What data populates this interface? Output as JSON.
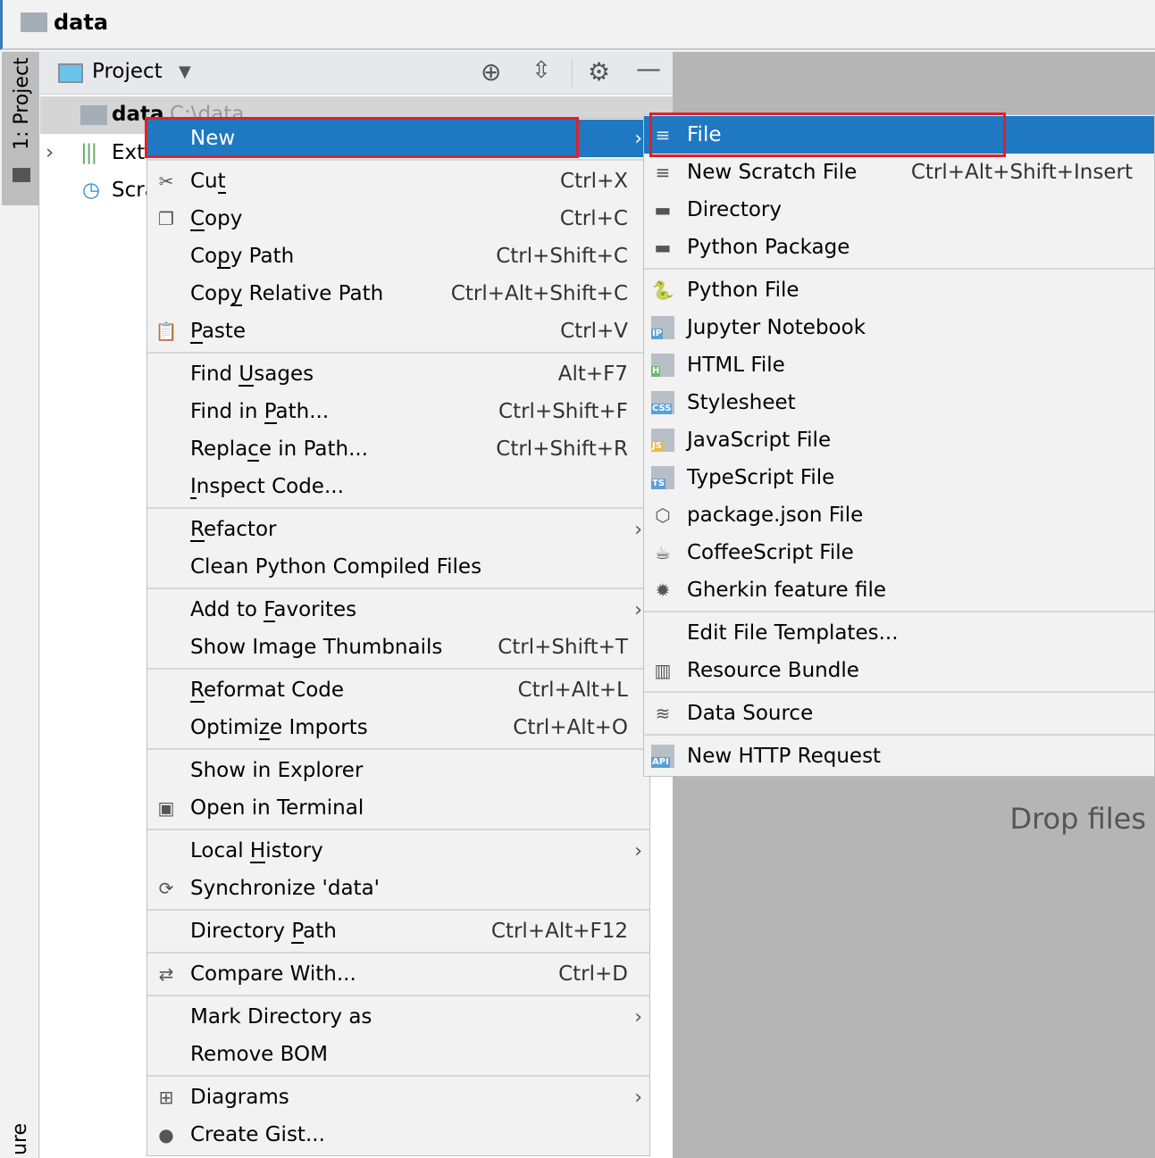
{
  "window": {
    "title": "data"
  },
  "sidebar": {
    "tab_label": "1: Project",
    "bottom_label": "ure"
  },
  "project_panel": {
    "title": "Project",
    "tree": [
      {
        "label": "data",
        "path": "C:\\data"
      },
      {
        "label": "Exte"
      },
      {
        "label": "Scra"
      }
    ]
  },
  "editor": {
    "drop_hint": "Drop files"
  },
  "context_menu": {
    "groups": [
      [
        {
          "label": "New",
          "submenu": true,
          "selected": true
        }
      ],
      [
        {
          "label": "Cut",
          "mn": 2,
          "shortcut": "Ctrl+X",
          "icon": "scissors-icon",
          "glyph": "✂"
        },
        {
          "label": "Copy",
          "mn": 0,
          "shortcut": "Ctrl+C",
          "icon": "copy-icon",
          "glyph": "❐"
        },
        {
          "label": "Copy Path",
          "mn": 2,
          "shortcut": "Ctrl+Shift+C"
        },
        {
          "label": "Copy Relative Path",
          "mn": 3,
          "shortcut": "Ctrl+Alt+Shift+C"
        },
        {
          "label": "Paste",
          "mn": 0,
          "shortcut": "Ctrl+V",
          "icon": "paste-icon",
          "glyph": "📋"
        }
      ],
      [
        {
          "label": "Find Usages",
          "mn": 5,
          "shortcut": "Alt+F7"
        },
        {
          "label": "Find in Path...",
          "mn": 8,
          "shortcut": "Ctrl+Shift+F"
        },
        {
          "label": "Replace in Path...",
          "mn": 5,
          "shortcut": "Ctrl+Shift+R"
        },
        {
          "label": "Inspect Code...",
          "mn": 0
        }
      ],
      [
        {
          "label": "Refactor",
          "mn": 0,
          "submenu": true
        },
        {
          "label": "Clean Python Compiled Files"
        }
      ],
      [
        {
          "label": "Add to Favorites",
          "mn": 7,
          "submenu": true
        },
        {
          "label": "Show Image Thumbnails",
          "shortcut": "Ctrl+Shift+T"
        }
      ],
      [
        {
          "label": "Reformat Code",
          "mn": 0,
          "shortcut": "Ctrl+Alt+L"
        },
        {
          "label": "Optimize Imports",
          "mn": 6,
          "shortcut": "Ctrl+Alt+O"
        }
      ],
      [
        {
          "label": "Show in Explorer"
        },
        {
          "label": "Open in Terminal",
          "icon": "terminal-icon",
          "glyph": "▣"
        }
      ],
      [
        {
          "label": "Local History",
          "mn": 6,
          "submenu": true
        },
        {
          "label": "Synchronize 'data'",
          "icon": "sync-icon",
          "glyph": "⟳"
        }
      ],
      [
        {
          "label": "Directory Path",
          "mn": 10,
          "shortcut": "Ctrl+Alt+F12"
        }
      ],
      [
        {
          "label": "Compare With...",
          "shortcut": "Ctrl+D",
          "icon": "compare-icon",
          "glyph": "⇄"
        }
      ],
      [
        {
          "label": "Mark Directory as",
          "submenu": true
        },
        {
          "label": "Remove BOM"
        }
      ],
      [
        {
          "label": "Diagrams",
          "submenu": true,
          "icon": "diagram-icon",
          "glyph": "⊞"
        },
        {
          "label": "Create Gist...",
          "icon": "github-icon",
          "glyph": "●"
        }
      ]
    ]
  },
  "new_submenu": {
    "groups": [
      [
        {
          "label": "File",
          "selected": true,
          "icon": "file-icon",
          "glyph": "≡"
        },
        {
          "label": "New Scratch File",
          "shortcut": "Ctrl+Alt+Shift+Insert",
          "icon": "scratch-file-icon",
          "glyph": "≡"
        },
        {
          "label": "Directory",
          "icon": "folder-icon",
          "glyph": "▬"
        },
        {
          "label": "Python Package",
          "icon": "package-icon",
          "glyph": "▬"
        }
      ],
      [
        {
          "label": "Python File",
          "icon": "python-icon",
          "glyph": "🐍"
        },
        {
          "label": "Jupyter Notebook",
          "icon": "jupyter-icon",
          "badge": "IP",
          "badge_color": "#5aa0d8"
        },
        {
          "label": "HTML File",
          "icon": "html-icon",
          "badge": "H",
          "badge_color": "#6bb86b"
        },
        {
          "label": "Stylesheet",
          "icon": "css-icon",
          "badge": "CSS",
          "badge_color": "#5aa0d8"
        },
        {
          "label": "JavaScript File",
          "icon": "js-icon",
          "badge": "JS",
          "badge_color": "#e8b84a"
        },
        {
          "label": "TypeScript File",
          "icon": "ts-icon",
          "badge": "TS",
          "badge_color": "#5aa0d8"
        },
        {
          "label": "package.json File",
          "icon": "nodejs-icon",
          "glyph": "⬡"
        },
        {
          "label": "CoffeeScript File",
          "icon": "coffee-icon",
          "glyph": "☕"
        },
        {
          "label": "Gherkin feature file",
          "icon": "cucumber-icon",
          "glyph": "✹"
        }
      ],
      [
        {
          "label": "Edit File Templates..."
        },
        {
          "label": "Resource Bundle",
          "icon": "resource-bundle-icon",
          "glyph": "▥"
        }
      ],
      [
        {
          "label": "Data Source",
          "icon": "database-icon",
          "glyph": "≋"
        }
      ],
      [
        {
          "label": "New HTTP Request",
          "icon": "api-icon",
          "badge": "API",
          "badge_color": "#5aa0d8"
        }
      ]
    ]
  },
  "colors": {
    "selection": "#1e78c2",
    "highlight_box": "#e0202a"
  }
}
